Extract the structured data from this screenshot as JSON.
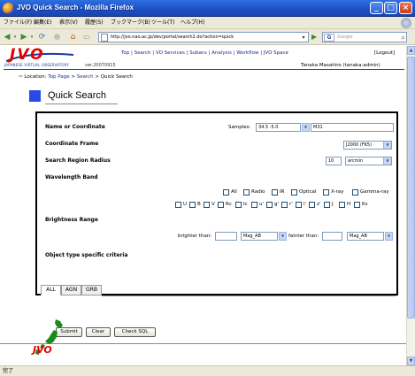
{
  "window": {
    "title": "JVO Quick Search - Mozilla Firefox"
  },
  "menubar": {
    "items": [
      "ファイル(F)",
      "編集(E)",
      "表示(V)",
      "履歴(S)",
      "ブックマーク(B)",
      "ツール(T)",
      "ヘルプ(H)"
    ]
  },
  "navbar": {
    "url": "http://jvo.nao.ac.jp/dev/portal/search2.do?action=quick",
    "search_placeholder": "Google",
    "search_engine": "G"
  },
  "header": {
    "logo_text": "JVO",
    "subtitle": "JAPANESE VIRTUAL OBSERVATORY",
    "version": "ver.20070915",
    "nav": [
      "Top",
      "Search",
      "VO Services",
      "Subaru",
      "Analysis",
      "Workflow",
      "JVO Space"
    ],
    "logout": "[Logout]",
    "user": "Tanaka Masahiro (tanaka:admin)",
    "location_prefix": "Location:",
    "location": [
      "Top Page",
      "Search",
      "Quick Search"
    ]
  },
  "page": {
    "title": "Quick Search"
  },
  "form": {
    "name_label": "Name or Coordinate",
    "samples_label": "Samples:",
    "samples_value": "34.5 -5.0",
    "name_value": "M31",
    "frame_label": "Coordinate Frame",
    "frame_value": "J2000 (FK5)",
    "radius_label": "Search Region Radius",
    "radius_value": "10",
    "radius_unit": "arcmin",
    "wave_label": "Wavelength Band",
    "bands_row1": [
      "All",
      "Radio",
      "IR",
      "Optical",
      "X-ray",
      "Gamma-ray"
    ],
    "bands_row2": [
      "U",
      "B",
      "V",
      "Rc",
      "Ic",
      "u'",
      "g'",
      "r'",
      "i'",
      "z'",
      "J",
      "H",
      "Ks"
    ],
    "bright_label": "Brightness Range",
    "brighter_label": "brighter than:",
    "brighter_unit": "Mag_AB",
    "fainter_label": "fainter than:",
    "fainter_unit": "Mag_AB",
    "object_label": "Object type specific criteria",
    "tabs": [
      "ALL",
      "AGN",
      "GRB"
    ]
  },
  "buttons": {
    "submit": "Submit",
    "clear": "Clear",
    "check_sql": "Check SQL"
  },
  "status": {
    "text": "完了"
  },
  "colors": {
    "logo_red": "#e00000",
    "accent_blue": "#2a4ae8",
    "link": "#1a2a8a"
  }
}
